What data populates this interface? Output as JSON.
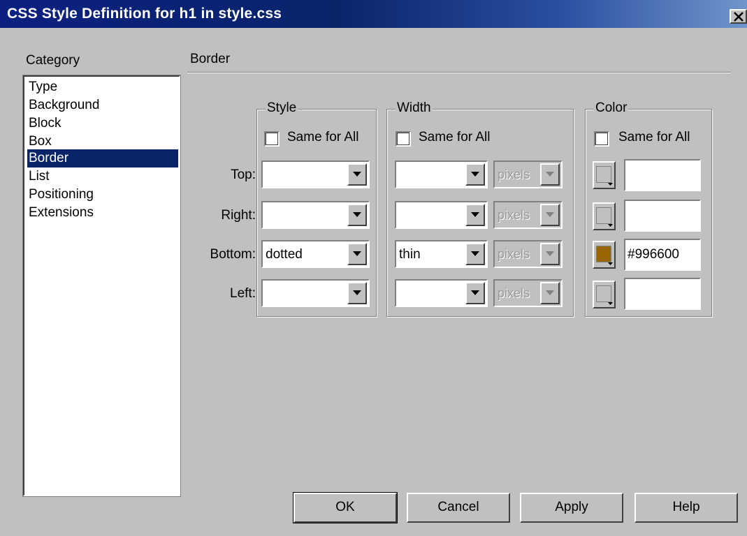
{
  "window": {
    "title": "CSS Style Definition for h1 in style.css",
    "close_glyph": "×"
  },
  "category": {
    "label": "Category",
    "items": [
      "Type",
      "Background",
      "Block",
      "Box",
      "Border",
      "List",
      "Positioning",
      "Extensions"
    ],
    "selected": "Border"
  },
  "panel": {
    "title": "Border"
  },
  "groups": {
    "style": {
      "title": "Style",
      "same_for_all": "Same for All"
    },
    "width": {
      "title": "Width",
      "same_for_all": "Same for All"
    },
    "color": {
      "title": "Color",
      "same_for_all": "Same for All"
    }
  },
  "rows": [
    {
      "label": "Top:",
      "style": "",
      "width": "",
      "unit": "pixels",
      "color": "",
      "swatch": "#c0c0c0"
    },
    {
      "label": "Right:",
      "style": "",
      "width": "",
      "unit": "pixels",
      "color": "",
      "swatch": "#c0c0c0"
    },
    {
      "label": "Bottom:",
      "style": "dotted",
      "width": "thin",
      "unit": "pixels",
      "color": "#996600",
      "swatch": "#996600"
    },
    {
      "label": "Left:",
      "style": "",
      "width": "",
      "unit": "pixels",
      "color": "",
      "swatch": "#c0c0c0"
    }
  ],
  "buttons": {
    "ok": "OK",
    "cancel": "Cancel",
    "apply": "Apply",
    "help": "Help"
  }
}
